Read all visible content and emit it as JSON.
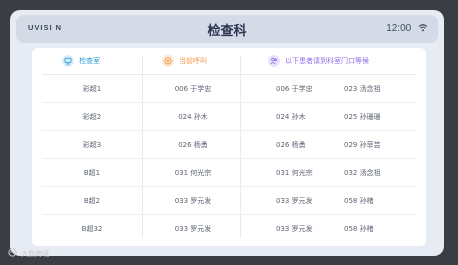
{
  "header": {
    "logo": "UVISI N",
    "title": "检查科",
    "time": "12:00"
  },
  "columns": {
    "room": "检查室",
    "current": "当前呼叫",
    "waiting": "以下患者请到科室门口等候"
  },
  "colors": {
    "room_accent": "#2d9cdb",
    "current_accent": "#f2994a",
    "waiting_accent": "#8e6ee8"
  },
  "rows": [
    {
      "room": "彩超1",
      "current": "006 于学忠",
      "wait1": "006 于学忠",
      "wait2": "023 汤念祖"
    },
    {
      "room": "彩超2",
      "current": "024 孙木",
      "wait1": "024 孙木",
      "wait2": "025 孙珊珊"
    },
    {
      "room": "彩超3",
      "current": "026 杨勇",
      "wait1": "026 杨勇",
      "wait2": "029 孙菲芸"
    },
    {
      "room": "B超1",
      "current": "031 何光宗",
      "wait1": "031 何光宗",
      "wait2": "032 汤念祖"
    },
    {
      "room": "B超2",
      "current": "033 罗元发",
      "wait1": "033 罗元发",
      "wait2": "058 孙楮"
    },
    {
      "room": "B超32",
      "current": "033 罗元发",
      "wait1": "033 罗元发",
      "wait2": "058 孙楮"
    }
  ],
  "icons": {
    "room": "info-screen-icon",
    "current": "call-icon",
    "waiting": "people-icon",
    "status": "wifi-icon",
    "watermark": "brand-logo-icon"
  },
  "watermark": "大数跨境"
}
